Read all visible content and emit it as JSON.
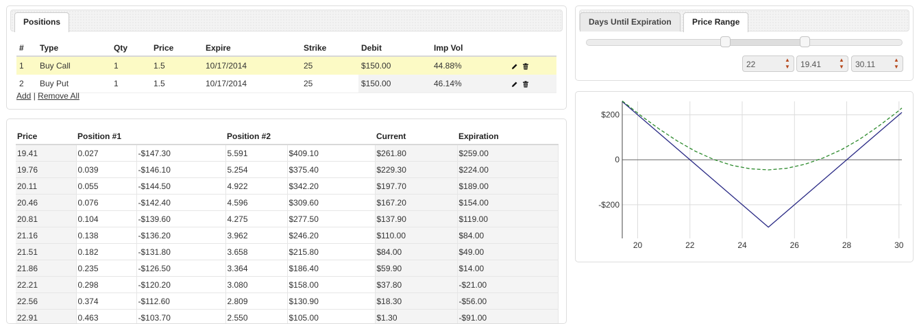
{
  "positions_panel": {
    "tab_label": "Positions",
    "columns": [
      "#",
      "Type",
      "Qty",
      "Price",
      "Expire",
      "Strike",
      "Debit",
      "Imp Vol"
    ],
    "rows": [
      {
        "num": "1",
        "type": "Buy Call",
        "qty": "1",
        "price": "1.5",
        "expire": "10/17/2014",
        "strike": "25",
        "debit": "$150.00",
        "imp_vol": "44.88%"
      },
      {
        "num": "2",
        "type": "Buy Put",
        "qty": "1",
        "price": "1.5",
        "expire": "10/17/2014",
        "strike": "25",
        "debit": "$150.00",
        "imp_vol": "46.14%"
      }
    ],
    "add_label": "Add",
    "separator": "|",
    "remove_all_label": "Remove All",
    "row_icons": [
      "pencil-icon",
      "trash-icon"
    ]
  },
  "price_table": {
    "columns": [
      "Price",
      "Position #1",
      "",
      "Position #2",
      "",
      "Current",
      "Expiration"
    ],
    "rows": [
      [
        "19.41",
        "0.027",
        "-$147.30",
        "5.591",
        "$409.10",
        "$261.80",
        "$259.00"
      ],
      [
        "19.76",
        "0.039",
        "-$146.10",
        "5.254",
        "$375.40",
        "$229.30",
        "$224.00"
      ],
      [
        "20.11",
        "0.055",
        "-$144.50",
        "4.922",
        "$342.20",
        "$197.70",
        "$189.00"
      ],
      [
        "20.46",
        "0.076",
        "-$142.40",
        "4.596",
        "$309.60",
        "$167.20",
        "$154.00"
      ],
      [
        "20.81",
        "0.104",
        "-$139.60",
        "4.275",
        "$277.50",
        "$137.90",
        "$119.00"
      ],
      [
        "21.16",
        "0.138",
        "-$136.20",
        "3.962",
        "$246.20",
        "$110.00",
        "$84.00"
      ],
      [
        "21.51",
        "0.182",
        "-$131.80",
        "3.658",
        "$215.80",
        "$84.00",
        "$49.00"
      ],
      [
        "21.86",
        "0.235",
        "-$126.50",
        "3.364",
        "$186.40",
        "$59.90",
        "$14.00"
      ],
      [
        "22.21",
        "0.298",
        "-$120.20",
        "3.080",
        "$158.00",
        "$37.80",
        "-$21.00"
      ],
      [
        "22.56",
        "0.374",
        "-$112.60",
        "2.809",
        "$130.90",
        "$18.30",
        "-$56.00"
      ],
      [
        "22.91",
        "0.463",
        "-$103.70",
        "2.550",
        "$105.00",
        "$1.30",
        "-$91.00"
      ]
    ]
  },
  "controls_panel": {
    "tabs": [
      "Days Until Expiration",
      "Price Range"
    ],
    "active_tab": "Price Range",
    "slider": {
      "min": 0,
      "max": 1,
      "range_start_frac": 0.438,
      "range_end_frac": 0.688
    },
    "spinners": [
      {
        "value": "22"
      },
      {
        "value": "19.41"
      },
      {
        "value": "30.11"
      }
    ]
  },
  "colors": {
    "highlight_row": "#fcfac5",
    "expiration_line": "#2a2a85",
    "current_line": "#2c8a2c",
    "spinner_arrow": "#b5481c"
  },
  "chart_data": {
    "type": "line",
    "xlim": [
      19.41,
      30.11
    ],
    "ylim": [
      -350,
      260
    ],
    "x_ticks": [
      20,
      22,
      24,
      26,
      28,
      30
    ],
    "y_ticks": [
      200,
      0,
      -200
    ],
    "y_tick_labels": [
      "$200",
      "0",
      "-$200"
    ],
    "grid": true,
    "series": [
      {
        "style": "solid",
        "x": [
          19.41,
          25,
          30.11
        ],
        "y": [
          259,
          -300,
          211
        ]
      },
      {
        "style": "dashed",
        "x": [
          19.41,
          20.11,
          20.81,
          21.51,
          22.21,
          22.91,
          23.61,
          24.31,
          25.0,
          25.7,
          26.4,
          27.1,
          27.8,
          28.5,
          29.2,
          29.9,
          30.11
        ],
        "y": [
          261.8,
          197.7,
          137.9,
          84.0,
          37.8,
          1.3,
          -25,
          -40,
          -45,
          -38,
          -20,
          8,
          45,
          92,
          148,
          210,
          230
        ]
      }
    ]
  }
}
